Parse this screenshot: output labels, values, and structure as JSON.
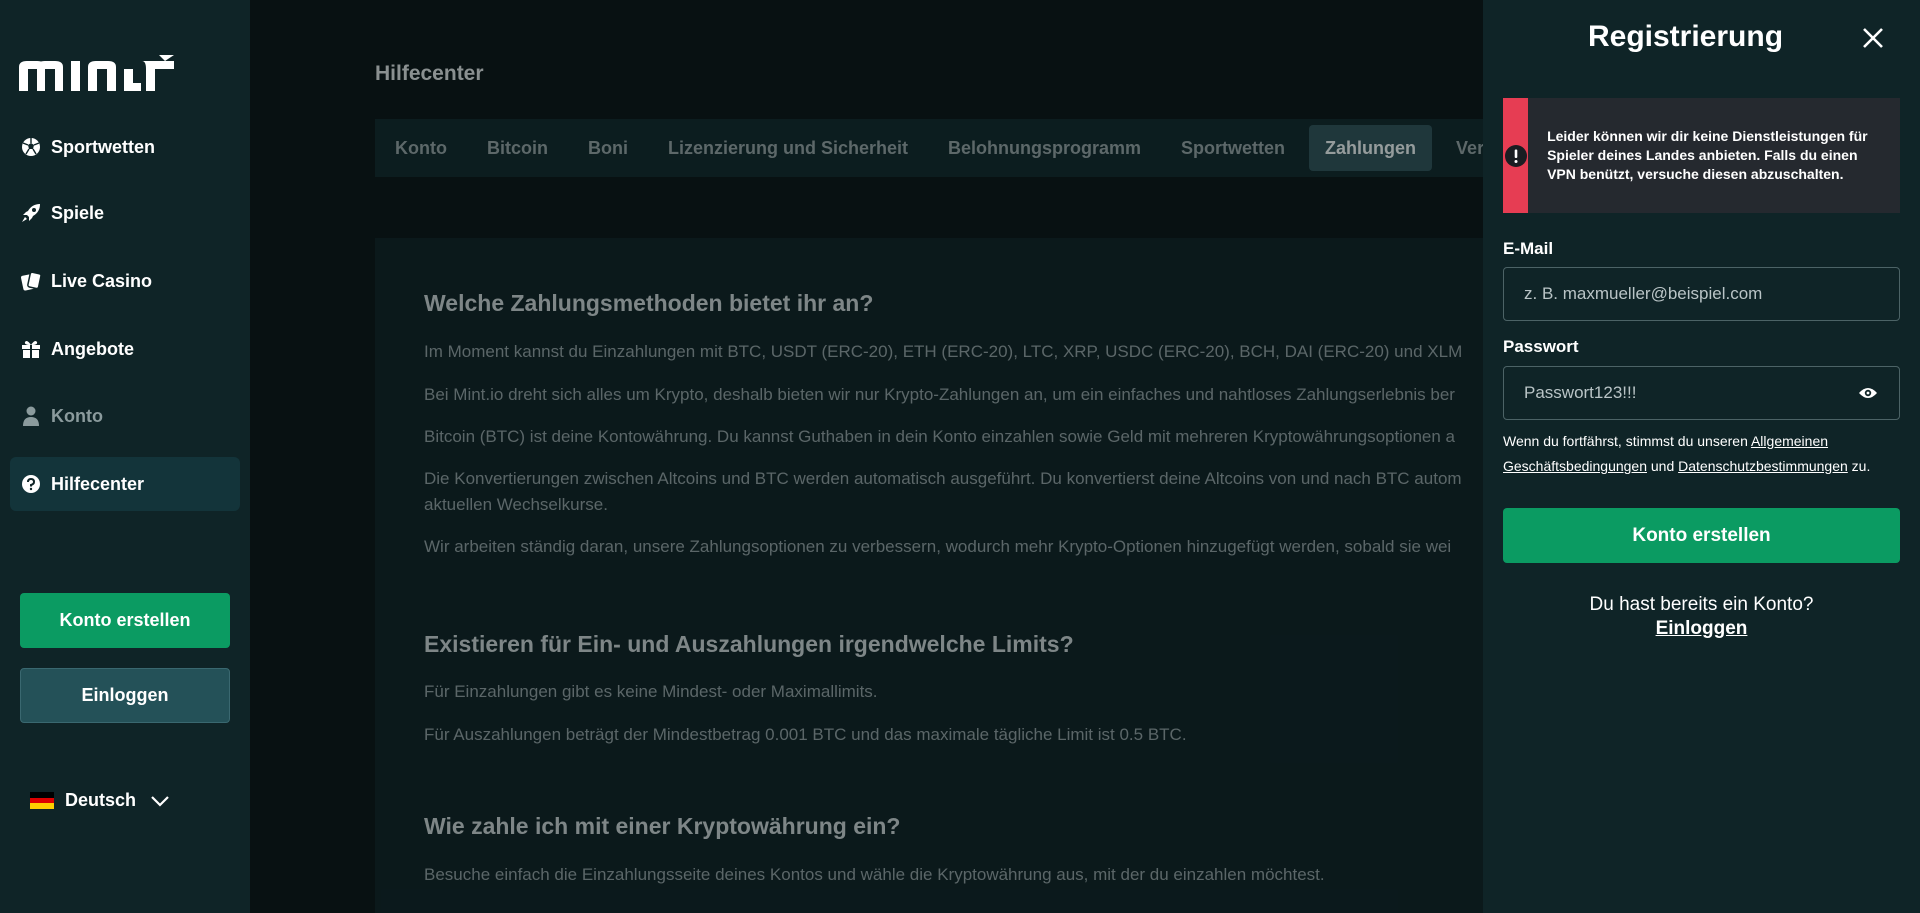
{
  "brand": {
    "logo_text": "mint"
  },
  "sidebar": {
    "items": [
      {
        "label": "Sportwetten",
        "icon": "soccer-ball-icon"
      },
      {
        "label": "Spiele",
        "icon": "rocket-icon"
      },
      {
        "label": "Live Casino",
        "icon": "cards-icon"
      },
      {
        "label": "Angebote",
        "icon": "gift-icon"
      },
      {
        "label": "Konto",
        "icon": "user-icon"
      },
      {
        "label": "Hilfecenter",
        "icon": "help-circle-icon"
      }
    ],
    "register_label": "Konto erstellen",
    "login_label": "Einloggen",
    "language": "Deutsch"
  },
  "main": {
    "title": "Hilfecenter",
    "tabs": [
      "Konto",
      "Bitcoin",
      "Boni",
      "Lizenzierung und Sicherheit",
      "Belohnungsprogramm",
      "Sportwetten",
      "Zahlungen",
      "Veram"
    ],
    "active_tab": "Zahlungen",
    "sections": [
      {
        "heading": "Welche Zahlungsmethoden bietet ihr an?",
        "paragraphs": [
          "Im Moment kannst du Einzahlungen mit BTC, USDT (ERC-20), ETH (ERC-20), LTC, XRP, USDC (ERC-20), BCH, DAI (ERC-20) und XLM",
          "Bei Mint.io dreht sich alles um Krypto, deshalb bieten wir nur Krypto-Zahlungen an, um ein einfaches und nahtloses Zahlungserlebnis ber",
          "Bitcoin (BTC) ist deine Kontowährung. Du kannst Guthaben in dein Konto einzahlen sowie Geld mit mehreren Kryptowährungsoptionen a",
          "Die Konvertierungen zwischen Altcoins und BTC werden automatisch ausgeführt. Du konvertierst deine Altcoins von und nach BTC autom",
          "aktuellen Wechselkurse.",
          "Wir arbeiten ständig daran, unsere Zahlungsoptionen zu verbessern, wodurch mehr Krypto-Optionen hinzugefügt werden, sobald sie wei"
        ]
      },
      {
        "heading": "Existieren für Ein- und Auszahlungen irgendwelche Limits?",
        "paragraphs": [
          "Für Einzahlungen gibt es keine Mindest- oder Maximallimits.",
          "Für Auszahlungen beträgt der Mindestbetrag 0.001 BTC und das maximale tägliche Limit ist 0.5 BTC."
        ]
      },
      {
        "heading": "Wie zahle ich mit einer Kryptowährung ein?",
        "paragraphs": [
          "Besuche einfach die Einzahlungsseite deines Kontos und wähle die Kryptowährung aus, mit der du einzahlen möchtest."
        ]
      }
    ]
  },
  "register": {
    "title": "Registrierung",
    "alert": "Leider können wir dir keine Dienstleistungen für Spieler deines Landes anbieten. Falls du einen VPN benützt, versuche diesen abzuschalten.",
    "email_label": "E-Mail",
    "email_placeholder": "z. B. maxmueller@beispiel.com",
    "password_label": "Passwort",
    "password_value": "Passwort123!!!",
    "terms_prefix": "Wenn du fortfährst, stimmst du unseren ",
    "terms_link": "Allgemeinen Geschäftsbedingungen",
    "terms_middle": " und ",
    "privacy_link": "Datenschutzbestimmungen",
    "terms_suffix": " zu.",
    "submit_label": "Konto erstellen",
    "already_text": "Du hast bereits ein Konto?",
    "login_link": "Einloggen"
  },
  "colors": {
    "sidebar_bg": "#0f2427",
    "main_bg": "#0b1719",
    "accent_green": "#0b9b62",
    "alert_red": "#e63d53"
  }
}
